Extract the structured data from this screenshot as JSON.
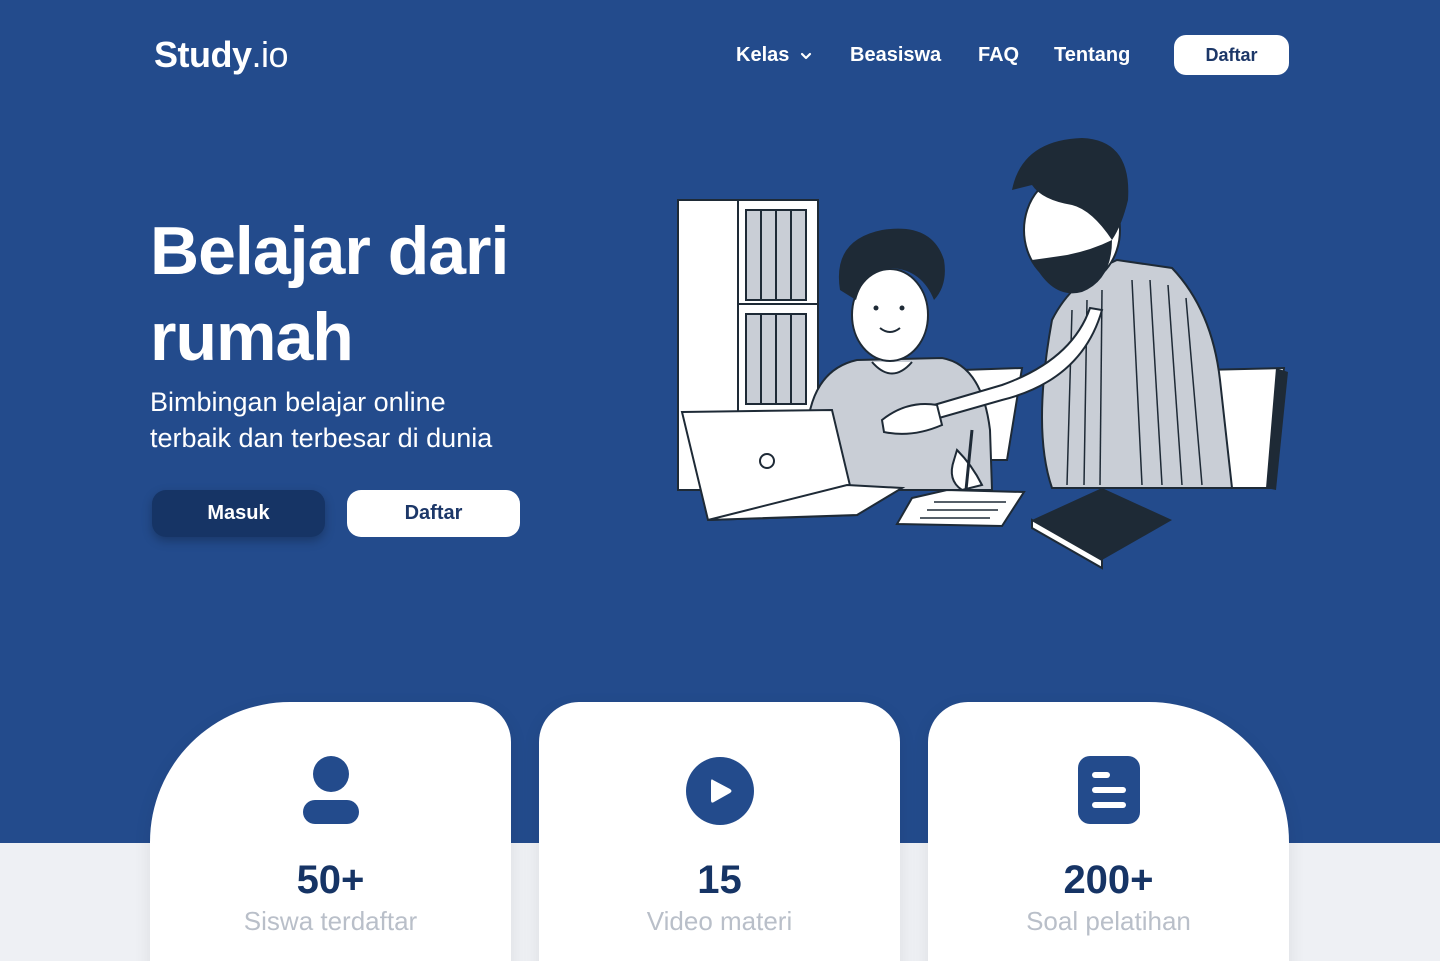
{
  "brand": {
    "name_bold": "Study",
    "name_light": ".io"
  },
  "nav": {
    "items": [
      {
        "label": "Kelas",
        "has_dropdown": true
      },
      {
        "label": "Beasiswa"
      },
      {
        "label": "FAQ"
      },
      {
        "label": "Tentang"
      }
    ],
    "cta_label": "Daftar"
  },
  "hero": {
    "headline_line1": "Belajar dari",
    "headline_line2": "rumah",
    "subheadline_line1": "Bimbingan belajar online",
    "subheadline_line2": "terbaik dan terbesar di dunia",
    "login_label": "Masuk",
    "register_label": "Daftar"
  },
  "stats": [
    {
      "icon": "user-icon",
      "value": "50+",
      "label": "Siswa terdaftar"
    },
    {
      "icon": "play-icon",
      "value": "15",
      "label": "Video materi"
    },
    {
      "icon": "document-icon",
      "value": "200+",
      "label": "Soal pelatihan"
    }
  ],
  "colors": {
    "primary": "#234b8c",
    "primary_dark": "#163465",
    "text_muted": "#b9bfc9",
    "background_light": "#eef0f4"
  }
}
